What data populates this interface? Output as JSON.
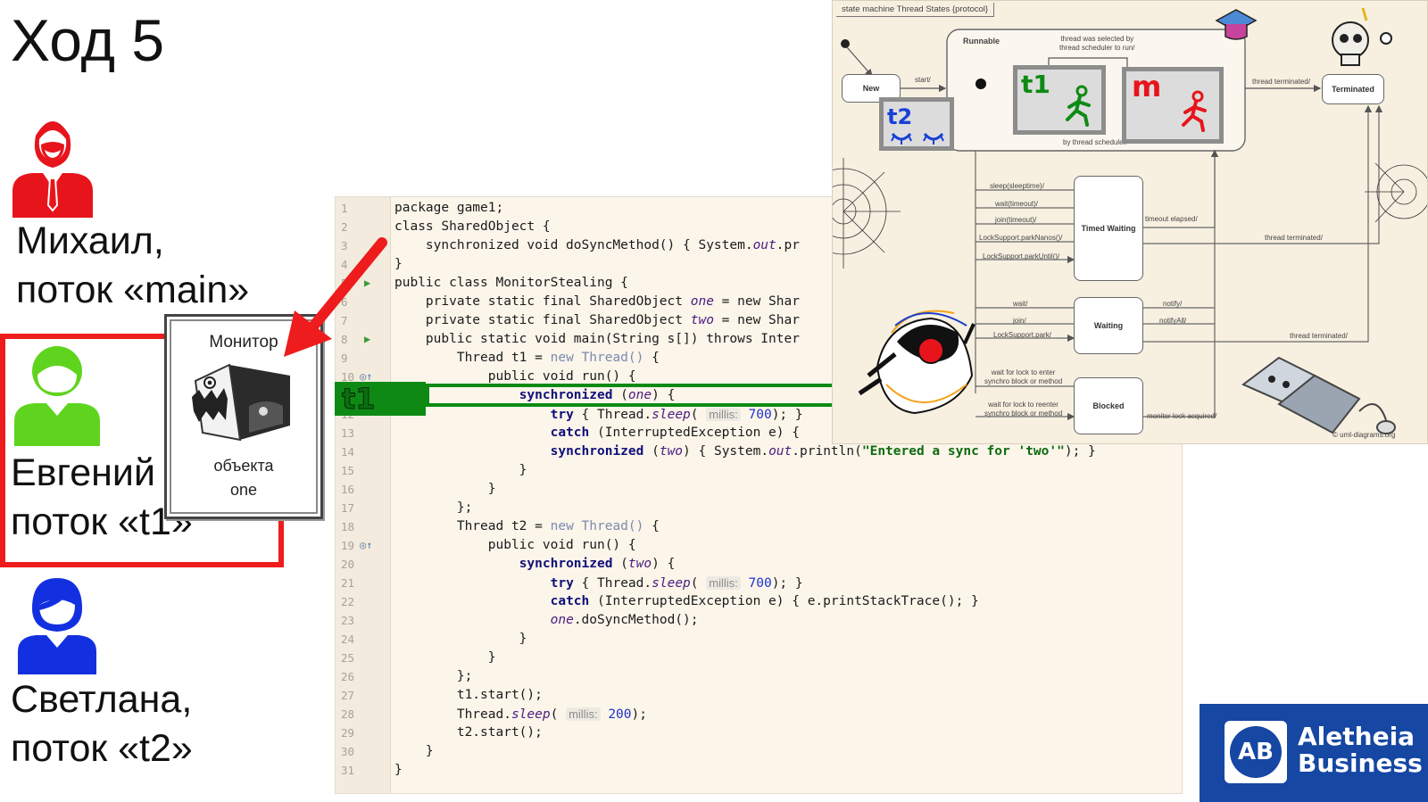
{
  "slide": {
    "title": "Ход 5"
  },
  "people": [
    {
      "name": "Михаил,",
      "thread": "поток «main»",
      "color": "#e8141c",
      "icon": "businessman-icon"
    },
    {
      "name": "Евгений",
      "thread": "поток «t1»",
      "color": "#5fd41e",
      "icon": "user-icon"
    },
    {
      "name": "Светлана,",
      "thread": "поток «t2»",
      "color": "#1330e0",
      "icon": "woman-icon"
    }
  ],
  "highlight_color": "#ee1c1c",
  "monitor": {
    "title": "Монитор",
    "subtitle_line1": "объекта",
    "subtitle_line2": "one",
    "icon": "monster-mailbox-icon"
  },
  "code": {
    "lines": [
      {
        "n": "1",
        "html": "package game1;"
      },
      {
        "n": "2",
        "html": "class SharedObject {"
      },
      {
        "n": "3",
        "html": "    synchronized void doSyncMethod() { System.<i class=\"it\">out</i>.pr"
      },
      {
        "n": "4",
        "html": "}"
      },
      {
        "n": "5",
        "html": "public class MonitorStealing {"
      },
      {
        "n": "6",
        "html": "    private static final SharedObject <i class=\"it\">one</i> = new Shar"
      },
      {
        "n": "7",
        "html": "    private static final SharedObject <i class=\"it\">two</i> = new Shar"
      },
      {
        "n": "8",
        "html": "    public static void main(String s[]) throws Inter"
      },
      {
        "n": "9",
        "html": "        Thread t1 = <span class=\"gr\">new Thread()</span> {"
      },
      {
        "n": "10",
        "html": "            public void run() {"
      },
      {
        "n": "11",
        "html": "                <span class=\"kw\">synchronized</span> (<i class=\"it\">one</i>) {"
      },
      {
        "n": "12",
        "html": "                    <span class=\"kw\">try</span> { Thread.<i class=\"it\">sleep</i>( <span class=\"hint\">millis:</span> <span class=\"num\">700</span>); }"
      },
      {
        "n": "13",
        "html": "                    <span class=\"kw\">catch</span> (InterruptedException e) {"
      },
      {
        "n": "14",
        "html": "                    <span class=\"kw\">synchronized</span> (<i class=\"it\">two</i>) { System.<i class=\"it\">out</i>.println(<span class=\"str\">\"Entered a sync for 'two'\"</span>); }"
      },
      {
        "n": "15",
        "html": "                }"
      },
      {
        "n": "16",
        "html": "            }"
      },
      {
        "n": "17",
        "html": "        };"
      },
      {
        "n": "18",
        "html": "        Thread t2 = <span class=\"gr\">new Thread()</span> {"
      },
      {
        "n": "19",
        "html": "            public void run() {"
      },
      {
        "n": "20",
        "html": "                <span class=\"kw\">synchronized</span> (<i class=\"it\">two</i>) {"
      },
      {
        "n": "21",
        "html": "                    <span class=\"kw\">try</span> { Thread.<i class=\"it\">sleep</i>( <span class=\"hint\">millis:</span> <span class=\"num\">700</span>); }"
      },
      {
        "n": "22",
        "html": "                    <span class=\"kw\">catch</span> (InterruptedException e) { e.printStackTrace(); }"
      },
      {
        "n": "23",
        "html": "                    <i class=\"it\">one</i>.doSyncMethod();"
      },
      {
        "n": "24",
        "html": "                }"
      },
      {
        "n": "25",
        "html": "            }"
      },
      {
        "n": "26",
        "html": "        };"
      },
      {
        "n": "27",
        "html": "        t1.start();"
      },
      {
        "n": "28",
        "html": "        Thread.<i class=\"it\">sleep</i>( <span class=\"hint\">millis:</span> <span class=\"num\">200</span>);"
      },
      {
        "n": "29",
        "html": "        t2.start();"
      },
      {
        "n": "30",
        "html": "    }"
      },
      {
        "n": "31",
        "html": "}"
      }
    ],
    "run_marker_lines": [
      5,
      8
    ],
    "override_marker_lines": [
      10,
      19
    ],
    "active_marker_label": "t1",
    "active_line": 11
  },
  "diagram": {
    "title": "state machine Thread States {protocol}",
    "states": {
      "new": "New",
      "runnable": "Runnable",
      "terminated": "Terminated",
      "timed_waiting": "Timed Waiting",
      "waiting": "Waiting",
      "blocked": "Blocked"
    },
    "labels": {
      "start": "start/",
      "selected": "thread was selected by\nthread scheduler to run/",
      "suspended": "by thread scheduler/",
      "thread_terminated": "thread terminated/",
      "sleep": "sleep(sleeptime)/",
      "wait_timeout": "wait(timeout)/",
      "join_timeout": "join(timeout)/",
      "park_nanos": "LockSupport.parkNanos()/",
      "park_until": "LockSupport.parkUntil()/",
      "timeout_elapsed": "timeout elapsed/",
      "wait": "wait/",
      "join": "join/",
      "park": "LockSupport.park/",
      "notify": "notify/",
      "notify_all": "notifyAll/",
      "wait_lock_enter": "wait for lock to enter\nsynchro block or method",
      "wait_lock_reenter": "wait for lock to reenter\nsynchro block or method",
      "monitor_lock": "monitor lock acquired/",
      "copyright": "© uml-diagrams.org"
    },
    "thread_boxes": [
      {
        "label": "t2",
        "color": "#1a3fd6",
        "icon": "sleeping-eyes-icon"
      },
      {
        "label": "t1",
        "color": "#0e8a14",
        "icon": "running-man-icon"
      },
      {
        "label": "m",
        "color": "#e8141c",
        "icon": "running-man-icon"
      }
    ]
  },
  "logo": {
    "mark": "AB",
    "line1": "Aletheia",
    "line2": "Business",
    "color": "#1547a3"
  }
}
